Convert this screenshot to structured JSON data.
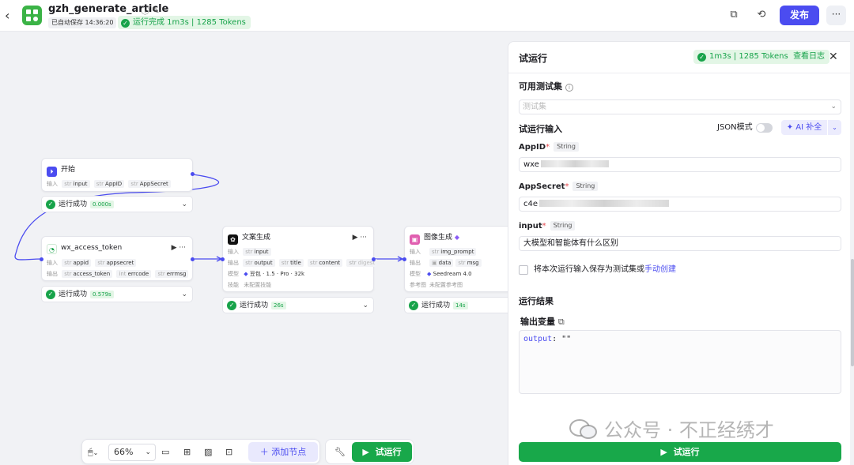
{
  "header": {
    "back_icon": "chevron-left-icon",
    "app_logo": "workflow-logo",
    "title": "gzh_generate_article",
    "autosave": "已自动保存 14:36:20",
    "run_status": "运行完成 1m3s | 1285 Tokens",
    "publish_label": "发布",
    "more_label": "···"
  },
  "canvas": {
    "nodes": {
      "start": {
        "title": "开始",
        "input_label": "输入",
        "params": [
          "input",
          "AppID",
          "AppSecret"
        ],
        "type_prefix": "str",
        "status": "运行成功",
        "time": "0.000s"
      },
      "token": {
        "title": "wx_access_token",
        "input_label": "输入",
        "output_label": "输出",
        "inputs": [
          "appid",
          "appsecret"
        ],
        "outputs": [
          "access_token",
          "errcode",
          "errmsg"
        ],
        "status": "运行成功",
        "time": "0.579s"
      },
      "copy": {
        "title": "文案生成",
        "input_label": "输入",
        "output_label": "输出",
        "model_label": "模型",
        "skill_label": "技能",
        "inputs": [
          "input"
        ],
        "outputs": [
          "output",
          "title",
          "content",
          "digest"
        ],
        "model": "豆包 · 1.5 · Pro · 32k",
        "skill": "未配置技能",
        "status": "运行成功",
        "time": "26s"
      },
      "image": {
        "title": "图像生成",
        "input_label": "输入",
        "output_label": "输出",
        "model_label": "模型",
        "ref_label": "参考图",
        "inputs": [
          "img_prompt"
        ],
        "outputs": [
          "data",
          "msg"
        ],
        "model": "Seedream 4.0",
        "ref": "未配置参考图",
        "status": "运行成功",
        "time": "14s"
      }
    }
  },
  "toolbar": {
    "zoom": "66%",
    "add_node": "添加节点",
    "trial_run": "试运行"
  },
  "panel": {
    "title": "试运行",
    "badge": "1m3s | 1285 Tokens",
    "view_log": "查看日志",
    "testset_label": "可用测试集",
    "testset_placeholder": "测试集",
    "input_section": "试运行输入",
    "json_mode": "JSON模式",
    "ai_fill": "AI 补全",
    "fields": [
      {
        "name": "AppID",
        "type": "String",
        "value": "wxe"
      },
      {
        "name": "AppSecret",
        "type": "String",
        "value": "c4e"
      },
      {
        "name": "input",
        "type": "String",
        "value": "大模型和智能体有什么区别"
      }
    ],
    "save_text": "将本次运行输入保存为测试集或",
    "save_link": "手动创建",
    "result_section": "运行结果",
    "output_var_label": "输出变量",
    "output_key": "output",
    "output_value": ": \"\"",
    "trial_run": "试运行"
  },
  "watermark": "公众号 · 不正经绣才",
  "colors": {
    "accent": "#4b4cf0",
    "success": "#17a34a",
    "run_button": "#18a84a",
    "logo": "#3bb346"
  }
}
